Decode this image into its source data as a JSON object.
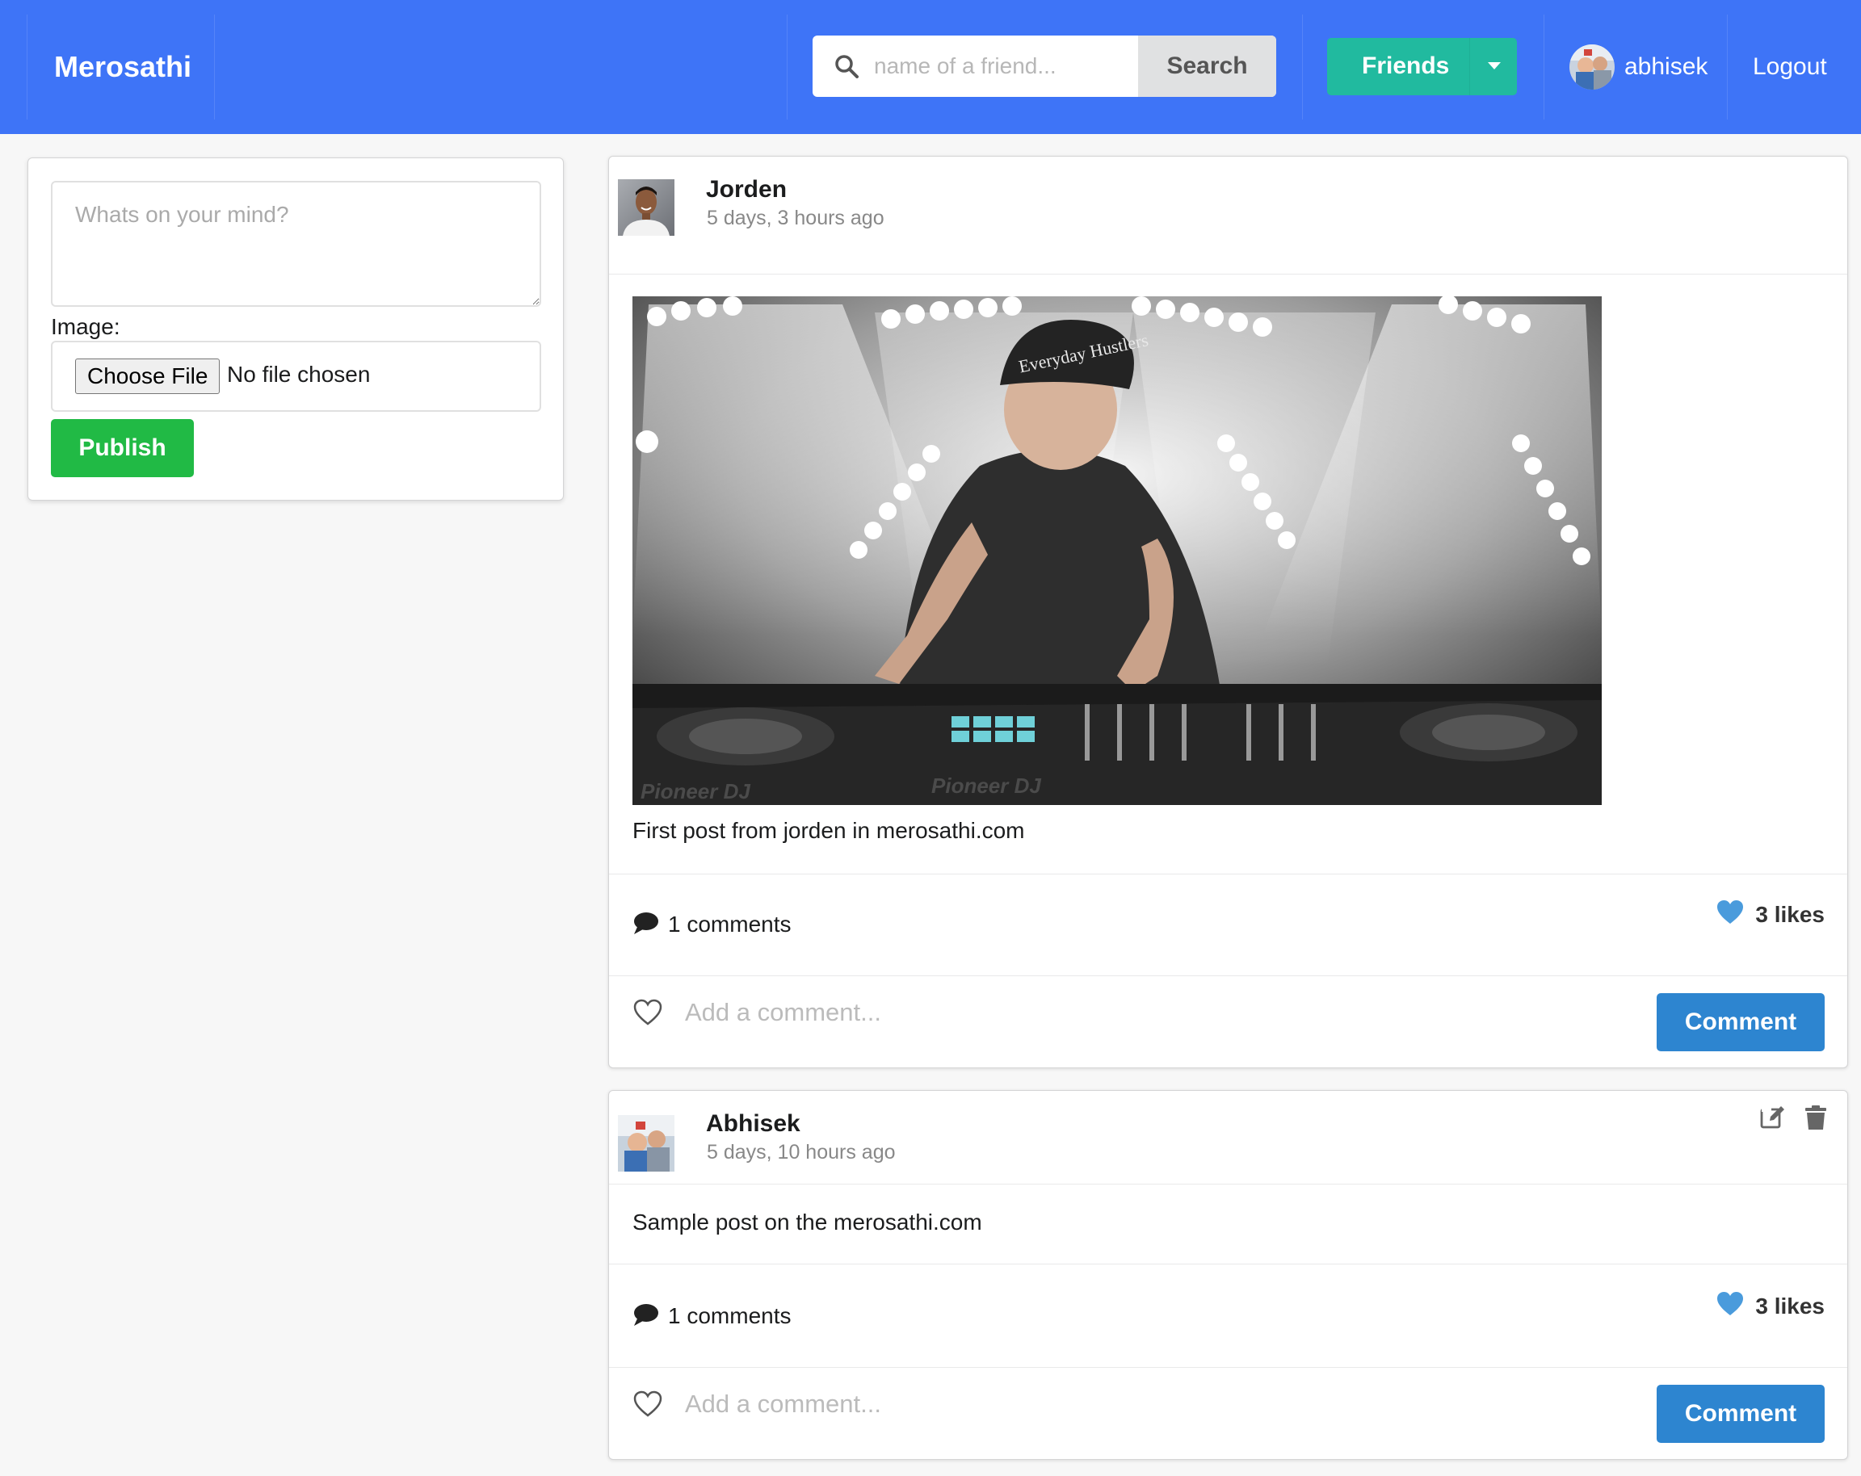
{
  "navbar": {
    "brand": "Merosathi",
    "search_placeholder": "name of a friend...",
    "search_button": "Search",
    "friends_button": "Friends",
    "username": "abhisek",
    "logout": "Logout"
  },
  "composer": {
    "placeholder": "Whats on your mind?",
    "image_label": "Image:",
    "choose_file": "Choose File",
    "file_status": "No file chosen",
    "publish": "Publish"
  },
  "posts": [
    {
      "author": "Jorden",
      "time": "5 days, 3 hours ago",
      "text": "First post from jorden in merosathi.com",
      "comments": "1 comments",
      "likes": "3 likes",
      "comment_placeholder": "Add a comment...",
      "comment_button": "Comment",
      "image_caption_cap": "Everyday Hustlers",
      "image_brand": "Pioneer DJ"
    },
    {
      "author": "Abhisek",
      "time": "5 days, 10 hours ago",
      "text": "Sample post on the merosathi.com",
      "comments": "1 comments",
      "likes": "3 likes",
      "comment_placeholder": "Add a comment...",
      "comment_button": "Comment"
    }
  ],
  "icons": {
    "search": "search-icon",
    "caret": "caret-down-icon",
    "comment": "comment-icon",
    "heart_filled": "heart-icon",
    "heart_outline": "heart-outline-icon",
    "edit": "edit-icon",
    "trash": "trash-icon"
  },
  "colors": {
    "navbar": "#3e74f7",
    "friends": "#21ba9f",
    "publish": "#21ba45",
    "comment_button": "#2d85d0",
    "heart": "#4a9bdc"
  }
}
